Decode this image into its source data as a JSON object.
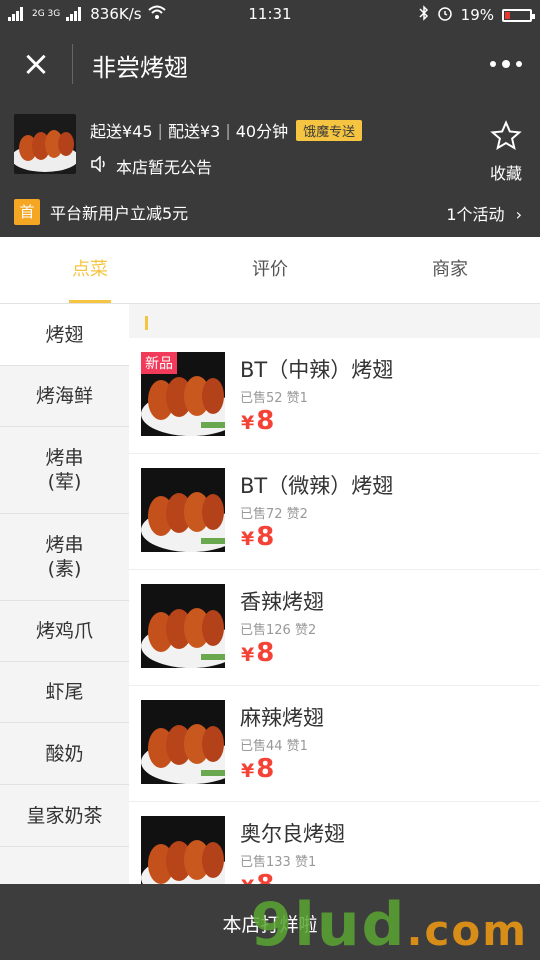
{
  "status_bar": {
    "network_left": "2G 3G",
    "speed": "836K/s",
    "time": "11:31",
    "battery": "19%",
    "icons": [
      "signal-icon",
      "wifi-icon",
      "bluetooth-icon",
      "alarm-icon",
      "battery-icon"
    ]
  },
  "header": {
    "title": "非尝烤翅",
    "close_icon": "×",
    "more_icon": "more-dots-icon"
  },
  "shop": {
    "min_order": "起送¥45",
    "delivery_fee": "配送¥3",
    "delivery_time": "40分钟",
    "delivery_badge": "饿魔专送",
    "notice": "本店暂无公告",
    "favorite_label": "收藏",
    "promo_badge": "首",
    "promo_text": "平台新用户立减5元",
    "activity_text": "1个活动",
    "colors": {
      "badge": "#f5c542",
      "promo": "#f5a623"
    }
  },
  "tabs": [
    {
      "label": "点菜",
      "active": true
    },
    {
      "label": "评价",
      "active": false
    },
    {
      "label": "商家",
      "active": false
    }
  ],
  "categories": [
    {
      "label": "烤翅",
      "active": true
    },
    {
      "label": "烤海鲜",
      "active": false
    },
    {
      "label": "烤串\n(荤)",
      "active": false
    },
    {
      "label": "烤串\n(素)",
      "active": false
    },
    {
      "label": "烤鸡爪",
      "active": false
    },
    {
      "label": "虾尾",
      "active": false
    },
    {
      "label": "酸奶",
      "active": false
    },
    {
      "label": "皇家奶茶",
      "active": false
    }
  ],
  "dishes": [
    {
      "name": "BT（中辣）烤翅",
      "stats": "已售52 赞1",
      "price": "8",
      "new_tag": "新品"
    },
    {
      "name": "BT（微辣）烤翅",
      "stats": "已售72 赞2",
      "price": "8"
    },
    {
      "name": "香辣烤翅",
      "stats": "已售126 赞2",
      "price": "8"
    },
    {
      "name": "麻辣烤翅",
      "stats": "已售44 赞1",
      "price": "8"
    },
    {
      "name": "奥尔良烤翅",
      "stats": "已售133 赞1",
      "price": "8"
    }
  ],
  "currency_symbol": "¥",
  "bottom_bar": {
    "text": "本店打烊啦",
    "watermark": "9lud",
    "watermark_suffix": ".com"
  }
}
